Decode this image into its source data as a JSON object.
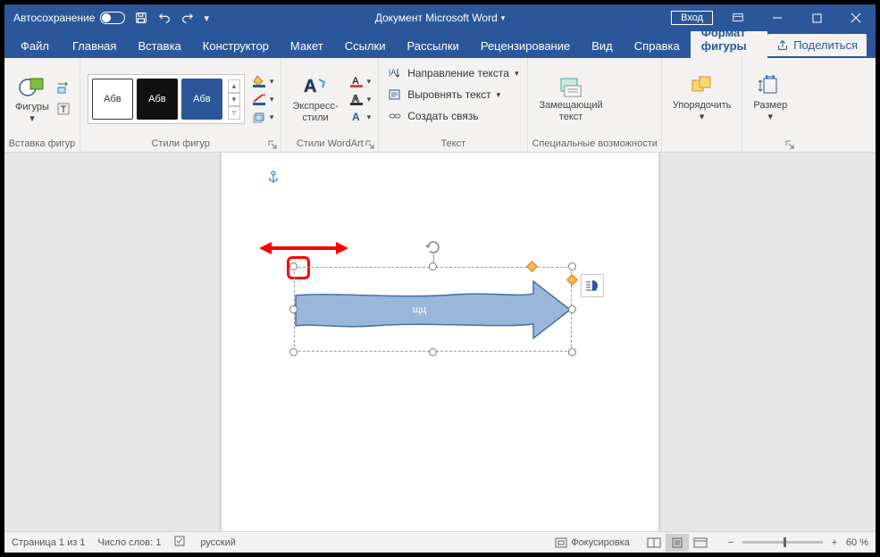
{
  "titlebar": {
    "autosave": "Автосохранение",
    "doc_title": "Документ Microsoft Word",
    "login": "Вход"
  },
  "tabs": {
    "file": "Файл",
    "home": "Главная",
    "insert": "Вставка",
    "design": "Конструктор",
    "layout": "Макет",
    "references": "Ссылки",
    "mailings": "Рассылки",
    "review": "Рецензирование",
    "view": "Вид",
    "help": "Справка",
    "shape_format": "Формат фигуры",
    "share": "Поделиться"
  },
  "ribbon": {
    "insert_shapes": {
      "shapes": "Фигуры",
      "label": "Вставка фигур"
    },
    "styles": {
      "swatch": "Абв",
      "label": "Стили фигур"
    },
    "wordart": {
      "express": "Экспресс-\nстили",
      "label": "Стили WordArt"
    },
    "text": {
      "direction": "Направление текста",
      "align": "Выровнять текст",
      "link": "Создать связь",
      "label": "Текст"
    },
    "accessibility": {
      "alt": "Замещающий\nтекст",
      "label": "Специальные возможности"
    },
    "arrange": {
      "btn": "Упорядочить",
      "label": ""
    },
    "size": {
      "btn": "Размер",
      "label": ""
    }
  },
  "shape": {
    "text": "щц"
  },
  "status": {
    "page": "Страница 1 из 1",
    "words": "Число слов: 1",
    "lang": "русский",
    "focus": "Фокусировка",
    "zoom": "60 %"
  }
}
